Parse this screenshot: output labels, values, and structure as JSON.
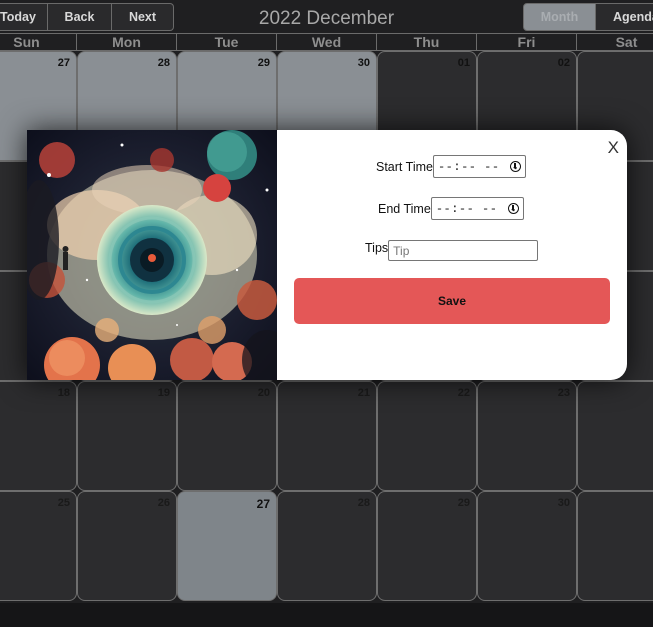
{
  "toolbar": {
    "today_label": "Today",
    "back_label": "Back",
    "next_label": "Next",
    "title": "2022 December",
    "month_label": "Month",
    "agenda_label": "Agenda"
  },
  "weekdays": [
    "Sun",
    "Mon",
    "Tue",
    "Wed",
    "Thu",
    "Fri",
    "Sat"
  ],
  "weeks": [
    [
      "27",
      "28",
      "29",
      "30",
      "01",
      "02",
      ""
    ],
    [
      "",
      "",
      "",
      "",
      "",
      "",
      ""
    ],
    [
      "",
      "",
      "",
      "",
      "",
      "",
      ""
    ],
    [
      "18",
      "19",
      "20",
      "21",
      "22",
      "23",
      ""
    ],
    [
      "25",
      "26",
      "27",
      "28",
      "29",
      "30",
      ""
    ]
  ],
  "modal": {
    "close_label": "X",
    "start_label": "Start Time",
    "start_value": "--:-- --",
    "end_label": "End Time",
    "end_value": "--:-- --",
    "tips_label": "Tips",
    "tip_placeholder": "Tip",
    "save_label": "Save"
  },
  "colors": {
    "background": "#1f1f21",
    "past_day": "#8a8f94",
    "save_button": "#e45757",
    "active_view": "#8a8f94"
  },
  "icons": [
    "clock-icon"
  ]
}
